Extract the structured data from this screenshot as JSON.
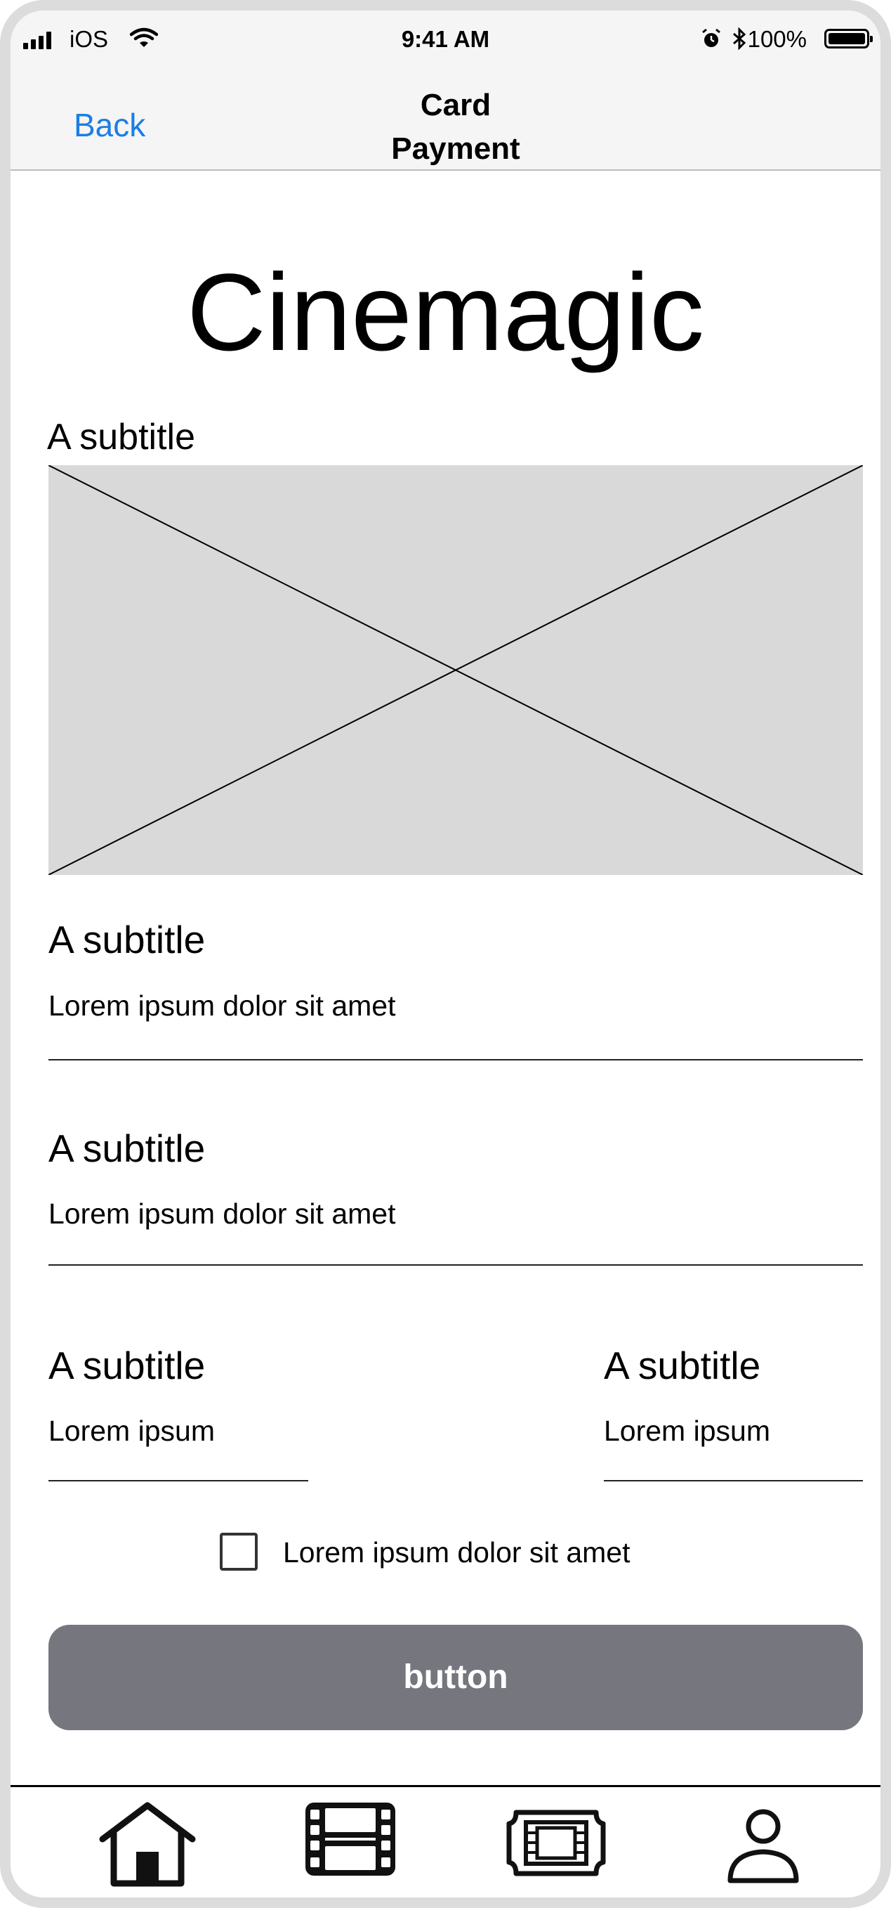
{
  "status_bar": {
    "carrier": "iOS",
    "time": "9:41 AM",
    "battery_percent": "100%",
    "icons": [
      "signal-icon",
      "wifi-icon",
      "alarm-icon",
      "bluetooth-icon",
      "battery-icon"
    ]
  },
  "nav": {
    "back_label": "Back",
    "title_line1": "Card",
    "title_line2": "Payment"
  },
  "brand": "Cinemagic",
  "image_section": {
    "subtitle": "A subtitle"
  },
  "fields": [
    {
      "subtitle": "A subtitle",
      "value": "Lorem ipsum dolor sit amet"
    },
    {
      "subtitle": "A subtitle",
      "value": "Lorem ipsum dolor sit amet"
    }
  ],
  "split_fields": [
    {
      "subtitle": "A subtitle",
      "value": "Lorem ipsum"
    },
    {
      "subtitle": "A subtitle",
      "value": "Lorem ipsum"
    }
  ],
  "checkbox": {
    "label": "Lorem ipsum dolor sit amet",
    "checked": false
  },
  "button": {
    "label": "button",
    "color": "#76767e"
  },
  "tab_bar": {
    "icons": [
      "home-icon",
      "film-strip-icon",
      "ticket-icon",
      "profile-icon"
    ]
  },
  "colors": {
    "link": "#1a7ee6",
    "placeholder_fill": "#d9d9d9",
    "frame": "#dcdcdc"
  }
}
